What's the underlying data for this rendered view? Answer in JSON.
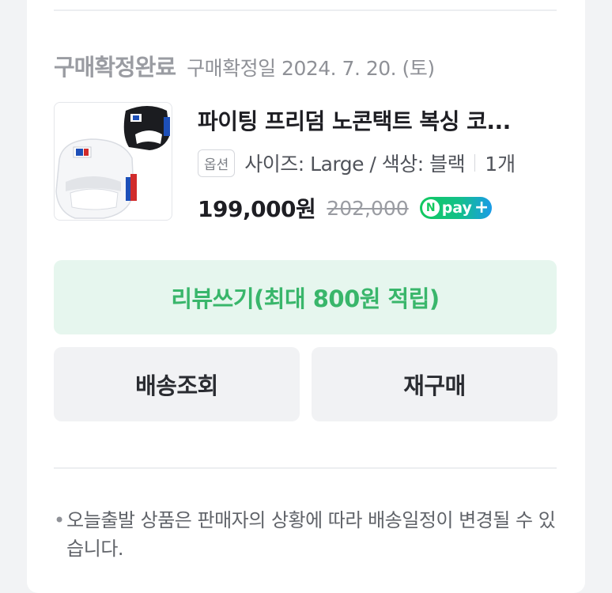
{
  "order": {
    "status": "구매확정완료",
    "confirm_date": "구매확정일 2024. 7. 20. (토)"
  },
  "product": {
    "name": "파이팅 프리덤 노콘택트 복싱 코...",
    "option_badge": "옵션",
    "option_text": "사이즈: Large / 색상: 블랙",
    "quantity": "1개",
    "price": "199,000원",
    "original_price": "202,000",
    "npay_label": "pay",
    "npay_n": "N",
    "npay_plus": "+"
  },
  "actions": {
    "review": "리뷰쓰기(최대 800원 적립)",
    "track": "배송조회",
    "rebuy": "재구매"
  },
  "notice": {
    "bullet": "•",
    "text": "오늘출발 상품은 판매자의 상황에 따라 배송일정이 변경될 수 있습니다."
  },
  "colors": {
    "review_bg": "#e6f6ee",
    "review_text": "#39b66b",
    "npay_green": "#12c95e",
    "npay_blue": "#1a9be8"
  }
}
